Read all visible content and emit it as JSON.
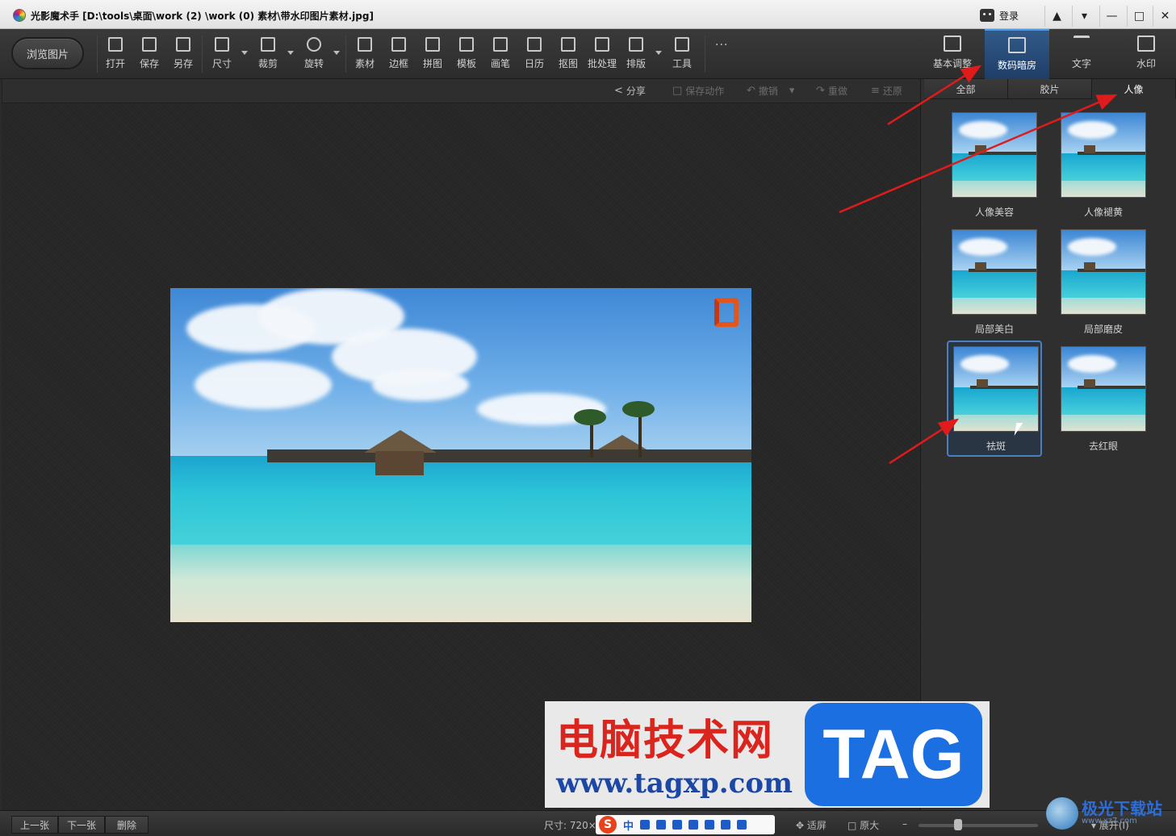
{
  "window": {
    "title": "光影魔术手 [D:\\tools\\桌面\\work (2) \\work (0) 素材\\带水印图片素材.jpg]",
    "login_label": "登录",
    "controls": [
      "skin",
      "menu",
      "minimize",
      "maximize",
      "close"
    ]
  },
  "toolbar": {
    "browse_label": "浏览图片",
    "tools": [
      {
        "label": "打开",
        "icon": "open-icon"
      },
      {
        "label": "保存",
        "icon": "save-icon"
      },
      {
        "label": "另存",
        "icon": "save-as-icon"
      },
      {
        "label": "尺寸",
        "icon": "resize-icon"
      },
      {
        "label": "裁剪",
        "icon": "crop-icon"
      },
      {
        "label": "旋转",
        "icon": "rotate-icon"
      },
      {
        "label": "素材",
        "icon": "material-icon"
      },
      {
        "label": "边框",
        "icon": "frame-icon"
      },
      {
        "label": "拼图",
        "icon": "collage-icon"
      },
      {
        "label": "模板",
        "icon": "template-icon"
      },
      {
        "label": "画笔",
        "icon": "brush-icon"
      },
      {
        "label": "日历",
        "icon": "calendar-icon"
      },
      {
        "label": "抠图",
        "icon": "cutout-icon"
      },
      {
        "label": "批处理",
        "icon": "batch-icon"
      },
      {
        "label": "排版",
        "icon": "layout-icon"
      },
      {
        "label": "工具",
        "icon": "wrench-icon"
      }
    ],
    "more_label": "..."
  },
  "right_tabs": [
    {
      "label": "基本调整",
      "icon": "edit-icon",
      "active": false
    },
    {
      "label": "数码暗房",
      "icon": "camera-icon",
      "active": true
    },
    {
      "label": "文字",
      "icon": "text-icon",
      "active": false
    },
    {
      "label": "水印",
      "icon": "watermark-icon",
      "active": false
    }
  ],
  "actions": {
    "share": "分享",
    "save_action": "保存动作",
    "undo": "撤销",
    "redo": "重做",
    "restore": "还原"
  },
  "subtabs": [
    {
      "label": "全部",
      "active": false
    },
    {
      "label": "胶片",
      "active": false
    },
    {
      "label": "人像",
      "active": true
    }
  ],
  "effects": [
    {
      "label": "人像美容",
      "selected": false
    },
    {
      "label": "人像褪黄",
      "selected": false
    },
    {
      "label": "局部美白",
      "selected": false
    },
    {
      "label": "局部磨皮",
      "selected": false
    },
    {
      "label": "祛斑",
      "selected": true
    },
    {
      "label": "去红眼",
      "selected": false
    }
  ],
  "statusbar": {
    "prev": "上一张",
    "next": "下一张",
    "delete": "删除",
    "size_label": "尺寸: 720×",
    "fit_screen": "适屏",
    "original": "原大",
    "expand": "展开(I)"
  },
  "ime": {
    "logo": "S",
    "mode": "中"
  },
  "watermark": {
    "title": "电脑技术网",
    "url": "www.tagxp.com",
    "tag": "TAG"
  },
  "site_logo": {
    "name": "极光下载站",
    "url": "www.xz7.com"
  },
  "colors": {
    "accent": "#1f3e66",
    "arrow": "#e01b1b",
    "selected_border": "#4a7fc0"
  }
}
